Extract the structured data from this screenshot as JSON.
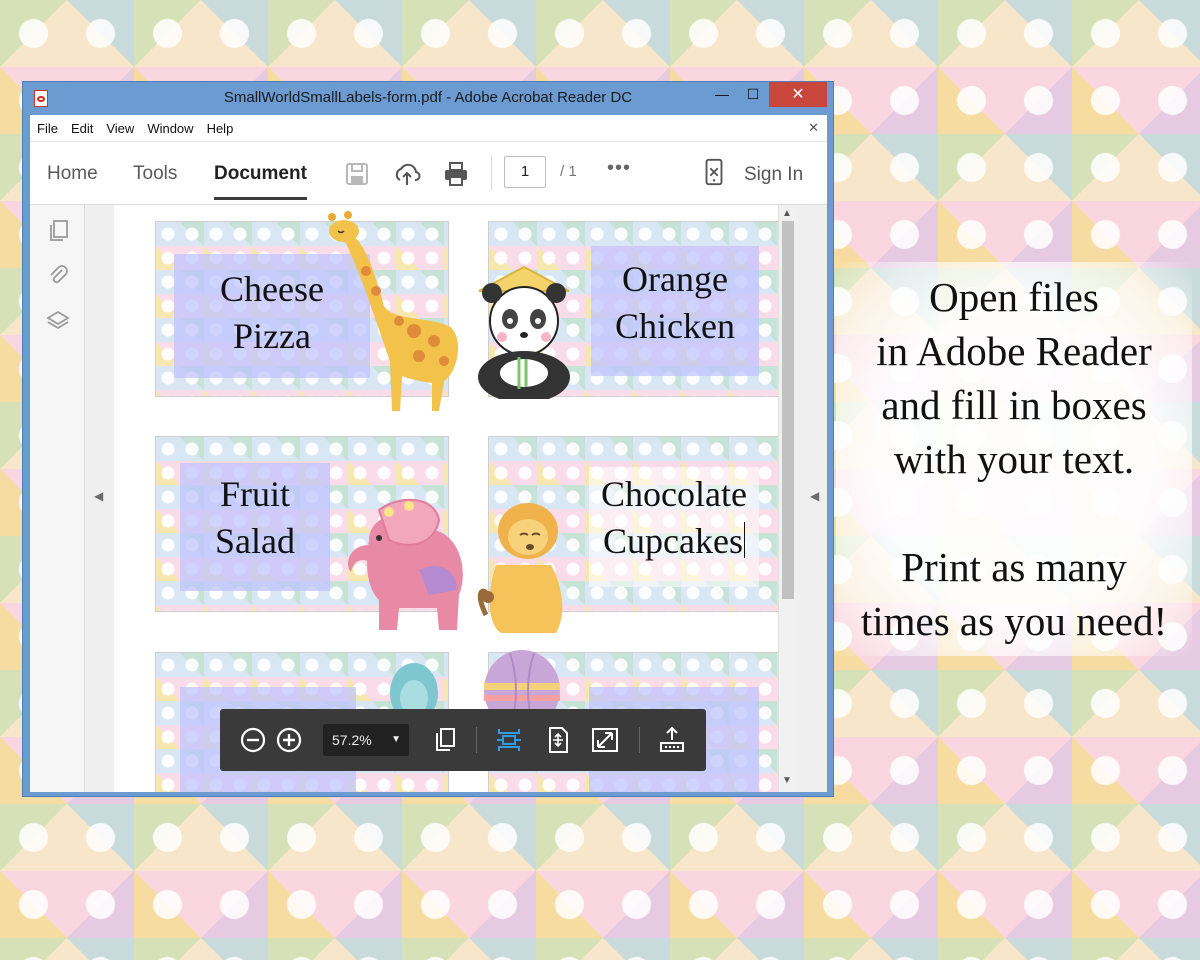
{
  "window": {
    "title": "SmallWorldSmallLabels-form.pdf - Adobe Acrobat Reader DC",
    "controls": {
      "minimize": "—",
      "maximize": "☐",
      "close": "✕"
    }
  },
  "menu": {
    "file": "File",
    "edit": "Edit",
    "view": "View",
    "window": "Window",
    "help": "Help",
    "close": "✕"
  },
  "toolbar": {
    "tabs": [
      "Home",
      "Tools",
      "Document"
    ],
    "active_tab": "Document",
    "page_current": "1",
    "page_total": "/ 1",
    "more": "•••",
    "sign_in": "Sign In"
  },
  "labels": {
    "l1": [
      "Cheese",
      "Pizza"
    ],
    "l2": [
      "Orange",
      "Chicken"
    ],
    "l3": [
      "Fruit",
      "Salad"
    ],
    "l4": [
      "Chocolate",
      "Cupcakes"
    ]
  },
  "zoom": {
    "value": "57.2%"
  },
  "caption": {
    "lines1": [
      "Open files",
      "in Adobe Reader",
      "and fill in boxes",
      "with your text."
    ],
    "lines2": [
      "Print as many",
      "times as you need!"
    ]
  },
  "colors": {
    "titlebar": "#6b9bd1",
    "close": "#c9463d",
    "field": "#bec4ff",
    "zoombar": "#3a3a3a",
    "accent_blue": "#2f9be6"
  }
}
